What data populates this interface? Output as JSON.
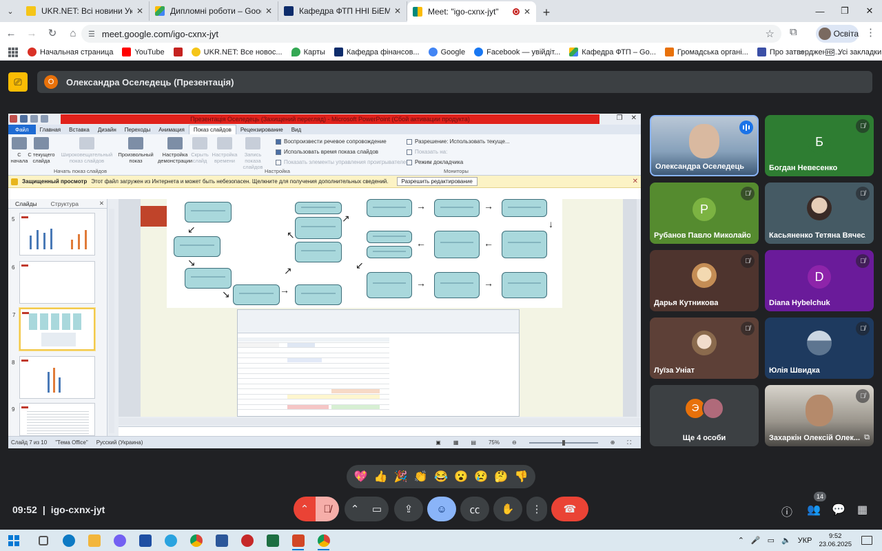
{
  "browser": {
    "tabs": [
      {
        "title": "UKR.NET: Всі новини України, ",
        "color": "#f5c518"
      },
      {
        "title": "Дипломні роботи – Google Ди",
        "color": "#1a73e8"
      },
      {
        "title": "Кафедра ФТП ННІ БіЕМ СумДУ",
        "color": "#0d2c6b"
      },
      {
        "title": "Meet: \"igo-cxnx-jyt\"",
        "color": "#00897b"
      }
    ],
    "url": "meet.google.com/igo-cxnx-jyt",
    "profile_label": "Освіта",
    "bookmarks": [
      {
        "label": "Начальная страница",
        "color": "#d93025"
      },
      {
        "label": "YouTube",
        "color": "#ff0000"
      },
      {
        "label": "",
        "color": "#c5221f"
      },
      {
        "label": "UKR.NET: Все новос...",
        "color": "#f5c518"
      },
      {
        "label": "Карты",
        "color": "#34a853"
      },
      {
        "label": "Кафедра фінансов...",
        "color": "#0d2c6b"
      },
      {
        "label": "Google",
        "color": "#4285f4"
      },
      {
        "label": "Facebook — увійдіт...",
        "color": "#1877f2"
      },
      {
        "label": "Кафедра ФТП – Go...",
        "color": "#1a73e8"
      },
      {
        "label": "Громадська органі...",
        "color": "#e8710a"
      },
      {
        "label": "Про затвердження...",
        "color": "#3b4fa6"
      }
    ],
    "all_bookmarks_label": "Усі закладки"
  },
  "meet": {
    "presenter_initial": "О",
    "presenter_title": "Олександра Оселедець (Презентація)",
    "meeting_code": "igo-cxnx-jyt",
    "time": "09:52",
    "participant_count": "14",
    "reactions": [
      "💖",
      "👍",
      "🎉",
      "👏",
      "😂",
      "😮",
      "😢",
      "🤔",
      "👎"
    ],
    "participants": [
      {
        "name": "Олександра Оселедець",
        "type": "video",
        "speaking": true,
        "bg": "#6d8aa8",
        "face": "#d9b9a0"
      },
      {
        "name": "Богдан Невесенко",
        "type": "letter",
        "letter": "Б",
        "bg": "#2e7d32",
        "muted": true
      },
      {
        "name": "Рубанов Павло Миколайович",
        "type": "letter",
        "letter": "Р",
        "bg": "#558b2f",
        "circle": "#7cb342",
        "muted": true
      },
      {
        "name": "Касьяненко Тетяна Вячеслав...",
        "type": "avatar",
        "bg": "#455a64",
        "face": "#e6cdb8",
        "muted": true
      },
      {
        "name": "Дарья Кутникова",
        "type": "avatar",
        "bg": "#4e342e",
        "face": "#f3d9b1",
        "muted": true
      },
      {
        "name": "Diana Hybelchuk",
        "type": "letter",
        "letter": "D",
        "bg": "#6a1b9a",
        "circle": "#8e24aa",
        "muted": true
      },
      {
        "name": "Луїза Уніат",
        "type": "avatar",
        "bg": "#5d4037",
        "face": "#f1dccc",
        "muted": true
      },
      {
        "name": "Юлія Швидка",
        "type": "avatar",
        "bg": "#1e3a5f",
        "face": "#8fa9c4",
        "muted": true
      },
      {
        "name": "Ще 4 особи",
        "type": "more",
        "letter": "Э",
        "bg": "#3c4043"
      },
      {
        "name": "Захаркін Олексій Олек...",
        "type": "video",
        "bg": "#8d8a84",
        "face": "#b58a6b",
        "muted": true
      }
    ]
  },
  "powerpoint": {
    "title": "Презентація Оселедець (Захищений перегляд) - Microsoft PowerPoint (Сбой активации продукта)",
    "tabs": [
      "Файл",
      "Главная",
      "Вставка",
      "Дизайн",
      "Переходы",
      "Анимация",
      "Показ слайдов",
      "Рецензирование",
      "Вид"
    ],
    "ribbon": {
      "btn_from_start": "С начала",
      "btn_from_current": "С текущего слайда",
      "btn_broadcast": "Широковещательный показ слайдов",
      "btn_custom": "Произвольный показ",
      "btn_setup": "Настройка демонстрации",
      "btn_hide": "Скрыть слайд",
      "btn_rehearse": "Настройка времени",
      "btn_record": "Запись показа слайдов",
      "group_start": "Начать показ слайдов",
      "group_setup": "Настройка",
      "group_monitors": "Мониторы",
      "chk_narration": "Воспроизвести речевое сопровождение",
      "chk_timings": "Использовать время показа слайдов",
      "chk_media": "Показать элементы управления проигрывателем",
      "resolution": "Разрешение: Использовать текуще...",
      "show_on": "Показать на:",
      "presenter_view": "Режим докладчика"
    },
    "security": {
      "bold": "Защищенный просмотр",
      "text": "Этот файл загружен из Интернета и может быть небезопасен. Щелкните для получения дополнительных сведений.",
      "button": "Разрешить редактирование"
    },
    "pane_tabs": [
      "Слайды",
      "Структура"
    ],
    "slide_numbers": [
      "5",
      "6",
      "7",
      "8",
      "9"
    ],
    "status": {
      "slide": "Слайд 7 из 10",
      "theme": "\"Тема Office\"",
      "lang": "Русский (Украина)",
      "zoom": "75%"
    }
  },
  "taskbar": {
    "lang": "УКР",
    "time": "9:52",
    "date": "23.06.2025",
    "apps": [
      {
        "name": "task-view",
        "color": "#555"
      },
      {
        "name": "edge",
        "color": "#0e7ac4"
      },
      {
        "name": "explorer",
        "color": "#f2b63c"
      },
      {
        "name": "viber",
        "color": "#7360f2"
      },
      {
        "name": "save",
        "color": "#1e4fa3"
      },
      {
        "name": "telegram",
        "color": "#2aa3df"
      },
      {
        "name": "chrome",
        "color": "#db4437"
      },
      {
        "name": "word",
        "color": "#2b579a"
      },
      {
        "name": "screen-app",
        "color": "#c62828"
      },
      {
        "name": "excel",
        "color": "#1d6f42"
      },
      {
        "name": "powerpoint",
        "color": "#d24726"
      },
      {
        "name": "chrome-active",
        "color": "#0f9d58"
      }
    ]
  }
}
